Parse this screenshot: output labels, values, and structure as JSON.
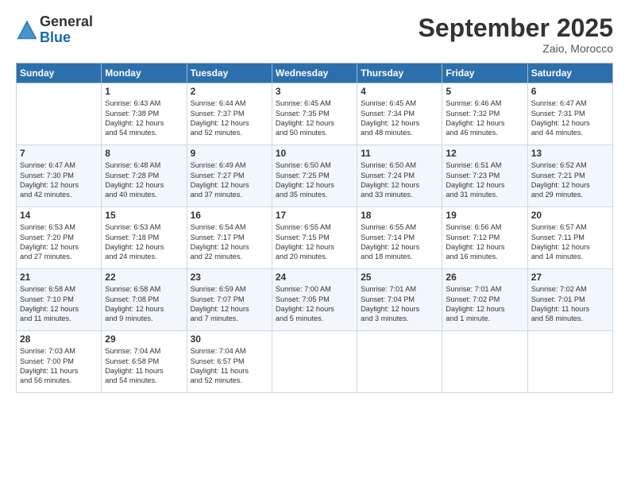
{
  "header": {
    "logo_general": "General",
    "logo_blue": "Blue",
    "month_title": "September 2025",
    "subtitle": "Zaio, Morocco"
  },
  "days_of_week": [
    "Sunday",
    "Monday",
    "Tuesday",
    "Wednesday",
    "Thursday",
    "Friday",
    "Saturday"
  ],
  "weeks": [
    [
      {
        "day": "",
        "content": ""
      },
      {
        "day": "1",
        "content": "Sunrise: 6:43 AM\nSunset: 7:38 PM\nDaylight: 12 hours\nand 54 minutes."
      },
      {
        "day": "2",
        "content": "Sunrise: 6:44 AM\nSunset: 7:37 PM\nDaylight: 12 hours\nand 52 minutes."
      },
      {
        "day": "3",
        "content": "Sunrise: 6:45 AM\nSunset: 7:35 PM\nDaylight: 12 hours\nand 50 minutes."
      },
      {
        "day": "4",
        "content": "Sunrise: 6:45 AM\nSunset: 7:34 PM\nDaylight: 12 hours\nand 48 minutes."
      },
      {
        "day": "5",
        "content": "Sunrise: 6:46 AM\nSunset: 7:32 PM\nDaylight: 12 hours\nand 46 minutes."
      },
      {
        "day": "6",
        "content": "Sunrise: 6:47 AM\nSunset: 7:31 PM\nDaylight: 12 hours\nand 44 minutes."
      }
    ],
    [
      {
        "day": "7",
        "content": "Sunrise: 6:47 AM\nSunset: 7:30 PM\nDaylight: 12 hours\nand 42 minutes."
      },
      {
        "day": "8",
        "content": "Sunrise: 6:48 AM\nSunset: 7:28 PM\nDaylight: 12 hours\nand 40 minutes."
      },
      {
        "day": "9",
        "content": "Sunrise: 6:49 AM\nSunset: 7:27 PM\nDaylight: 12 hours\nand 37 minutes."
      },
      {
        "day": "10",
        "content": "Sunrise: 6:50 AM\nSunset: 7:25 PM\nDaylight: 12 hours\nand 35 minutes."
      },
      {
        "day": "11",
        "content": "Sunrise: 6:50 AM\nSunset: 7:24 PM\nDaylight: 12 hours\nand 33 minutes."
      },
      {
        "day": "12",
        "content": "Sunrise: 6:51 AM\nSunset: 7:23 PM\nDaylight: 12 hours\nand 31 minutes."
      },
      {
        "day": "13",
        "content": "Sunrise: 6:52 AM\nSunset: 7:21 PM\nDaylight: 12 hours\nand 29 minutes."
      }
    ],
    [
      {
        "day": "14",
        "content": "Sunrise: 6:53 AM\nSunset: 7:20 PM\nDaylight: 12 hours\nand 27 minutes."
      },
      {
        "day": "15",
        "content": "Sunrise: 6:53 AM\nSunset: 7:18 PM\nDaylight: 12 hours\nand 24 minutes."
      },
      {
        "day": "16",
        "content": "Sunrise: 6:54 AM\nSunset: 7:17 PM\nDaylight: 12 hours\nand 22 minutes."
      },
      {
        "day": "17",
        "content": "Sunrise: 6:55 AM\nSunset: 7:15 PM\nDaylight: 12 hours\nand 20 minutes."
      },
      {
        "day": "18",
        "content": "Sunrise: 6:55 AM\nSunset: 7:14 PM\nDaylight: 12 hours\nand 18 minutes."
      },
      {
        "day": "19",
        "content": "Sunrise: 6:56 AM\nSunset: 7:12 PM\nDaylight: 12 hours\nand 16 minutes."
      },
      {
        "day": "20",
        "content": "Sunrise: 6:57 AM\nSunset: 7:11 PM\nDaylight: 12 hours\nand 14 minutes."
      }
    ],
    [
      {
        "day": "21",
        "content": "Sunrise: 6:58 AM\nSunset: 7:10 PM\nDaylight: 12 hours\nand 11 minutes."
      },
      {
        "day": "22",
        "content": "Sunrise: 6:58 AM\nSunset: 7:08 PM\nDaylight: 12 hours\nand 9 minutes."
      },
      {
        "day": "23",
        "content": "Sunrise: 6:59 AM\nSunset: 7:07 PM\nDaylight: 12 hours\nand 7 minutes."
      },
      {
        "day": "24",
        "content": "Sunrise: 7:00 AM\nSunset: 7:05 PM\nDaylight: 12 hours\nand 5 minutes."
      },
      {
        "day": "25",
        "content": "Sunrise: 7:01 AM\nSunset: 7:04 PM\nDaylight: 12 hours\nand 3 minutes."
      },
      {
        "day": "26",
        "content": "Sunrise: 7:01 AM\nSunset: 7:02 PM\nDaylight: 12 hours\nand 1 minute."
      },
      {
        "day": "27",
        "content": "Sunrise: 7:02 AM\nSunset: 7:01 PM\nDaylight: 11 hours\nand 58 minutes."
      }
    ],
    [
      {
        "day": "28",
        "content": "Sunrise: 7:03 AM\nSunset: 7:00 PM\nDaylight: 11 hours\nand 56 minutes."
      },
      {
        "day": "29",
        "content": "Sunrise: 7:04 AM\nSunset: 6:58 PM\nDaylight: 11 hours\nand 54 minutes."
      },
      {
        "day": "30",
        "content": "Sunrise: 7:04 AM\nSunset: 6:57 PM\nDaylight: 11 hours\nand 52 minutes."
      },
      {
        "day": "",
        "content": ""
      },
      {
        "day": "",
        "content": ""
      },
      {
        "day": "",
        "content": ""
      },
      {
        "day": "",
        "content": ""
      }
    ]
  ]
}
